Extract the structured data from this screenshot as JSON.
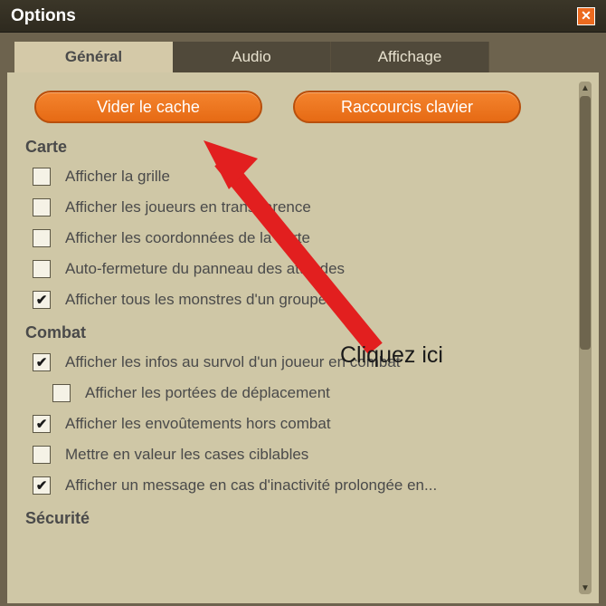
{
  "window": {
    "title": "Options"
  },
  "tabs": {
    "general": "Général",
    "audio": "Audio",
    "display": "Affichage",
    "active": "general"
  },
  "buttons": {
    "clear_cache": "Vider le cache",
    "shortcuts": "Raccourcis clavier"
  },
  "sections": {
    "map": {
      "heading": "Carte",
      "options": [
        {
          "label": "Afficher la grille",
          "checked": false
        },
        {
          "label": "Afficher les joueurs en transparence",
          "checked": false
        },
        {
          "label": "Afficher les coordonnées de la carte",
          "checked": false
        },
        {
          "label": "Auto-fermeture du panneau des attitudes",
          "checked": false
        },
        {
          "label": "Afficher tous les monstres d'un groupe",
          "checked": true
        }
      ]
    },
    "combat": {
      "heading": "Combat",
      "options": [
        {
          "label": "Afficher les infos au survol d'un joueur en combat",
          "checked": true
        },
        {
          "label": "Afficher les portées de déplacement",
          "checked": false,
          "indent": true
        },
        {
          "label": "Afficher les envoûtements hors combat",
          "checked": true
        },
        {
          "label": "Mettre en valeur les cases ciblables",
          "checked": false
        },
        {
          "label": "Afficher un message en cas d'inactivité prolongée en...",
          "checked": true
        }
      ]
    },
    "security": {
      "heading": "Sécurité"
    }
  },
  "annotation": {
    "text": "Cliquez ici"
  }
}
